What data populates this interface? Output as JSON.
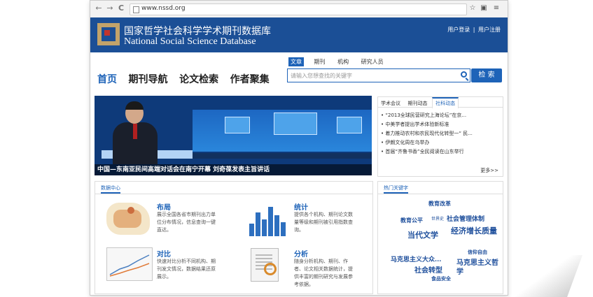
{
  "browser": {
    "url": "www.nssd.org",
    "back": "←",
    "forward": "→",
    "reload": "C",
    "star": "☆",
    "menu": "≡"
  },
  "header": {
    "title_cn": "国家哲学社会科学学术期刊数据库",
    "title_en": "National Social Science Database",
    "login": "用户登录",
    "sep": "|",
    "register": "用户注册"
  },
  "nav": {
    "items": [
      "首页",
      "期刊导航",
      "论文检索",
      "作者聚集"
    ]
  },
  "search": {
    "tabs": [
      "文章",
      "期刊",
      "机构",
      "研究人员"
    ],
    "placeholder": "请输入您想查找的关键字",
    "button": "检 索"
  },
  "banner": {
    "caption": "中国—东南亚民间高端对话会在南宁开幕 刘奇葆发表主旨讲话"
  },
  "news": {
    "tabs": [
      "学术会议",
      "期刊动态",
      "社科动态"
    ],
    "items": [
      "“2013全球民营研究上海论坛”在京...",
      "中美学者提出学术体验新标准",
      "着力推动农村和农民现代化转型一“ 民...",
      "伊朗文化周在乌举办",
      "首届“齐鲁书香”全民阅读在山东举行"
    ],
    "more": "更多>>"
  },
  "data_center": {
    "title": "数据中心",
    "items": [
      {
        "title": "布局",
        "desc": "展示全国各省市期刊出力单位分布情况，信息查询一键直达。"
      },
      {
        "title": "统计",
        "desc": "提供各个机构、期刊论文数量等级和期刊被引用指数查询。"
      },
      {
        "title": "对比",
        "desc": "快速对比分析不同机构、期刊发文情况，数据结果还原展示。"
      },
      {
        "title": "分析",
        "desc": "随身分析机构、期刊、作者、论文相关数据统计，提供丰富的期刊研究与发展参考依据。"
      }
    ]
  },
  "hot_keywords": {
    "title": "热门关键字",
    "words": [
      "教育改革",
      "教育公平",
      "世界史",
      "社会管理体制",
      "当代文学",
      "经济增长质量",
      "马克思主义大众...",
      "信仰自由",
      "社会转型",
      "马克思主义哲学",
      "食品安全"
    ]
  }
}
